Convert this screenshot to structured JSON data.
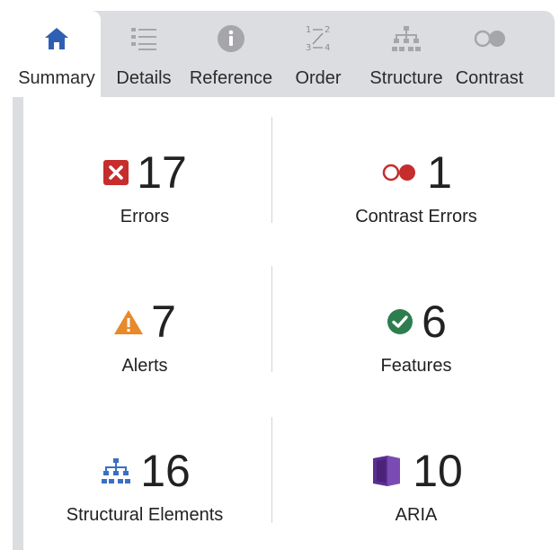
{
  "tabs": [
    {
      "label": "Summary",
      "icon": "home-icon",
      "active": true
    },
    {
      "label": "Details",
      "icon": "list-icon",
      "active": false
    },
    {
      "label": "Reference",
      "icon": "info-icon",
      "active": false
    },
    {
      "label": "Order",
      "icon": "order-icon",
      "active": false
    },
    {
      "label": "Structure",
      "icon": "hierarchy-icon",
      "active": false
    },
    {
      "label": "Contrast",
      "icon": "contrast-icon",
      "active": false
    }
  ],
  "summary": {
    "errors": {
      "count": "17",
      "label": "Errors",
      "icon": "error-icon",
      "color": "#c62d2d"
    },
    "contrast_errors": {
      "count": "1",
      "label": "Contrast Errors",
      "icon": "contrast-error-icon",
      "color": "#c62d2d"
    },
    "alerts": {
      "count": "7",
      "label": "Alerts",
      "icon": "alert-icon",
      "color": "#e8892b"
    },
    "features": {
      "count": "6",
      "label": "Features",
      "icon": "feature-icon",
      "color": "#2e7d4f"
    },
    "structural": {
      "count": "16",
      "label": "Structural Elements",
      "icon": "structure-icon",
      "color": "#3a6fc4"
    },
    "aria": {
      "count": "10",
      "label": "ARIA",
      "icon": "aria-icon",
      "color": "#5b2e91"
    }
  },
  "colors": {
    "tab_icon_active": "#2f5fb3",
    "tab_icon_inactive": "#a6a6aa",
    "frame_bg": "#dcdde1"
  }
}
